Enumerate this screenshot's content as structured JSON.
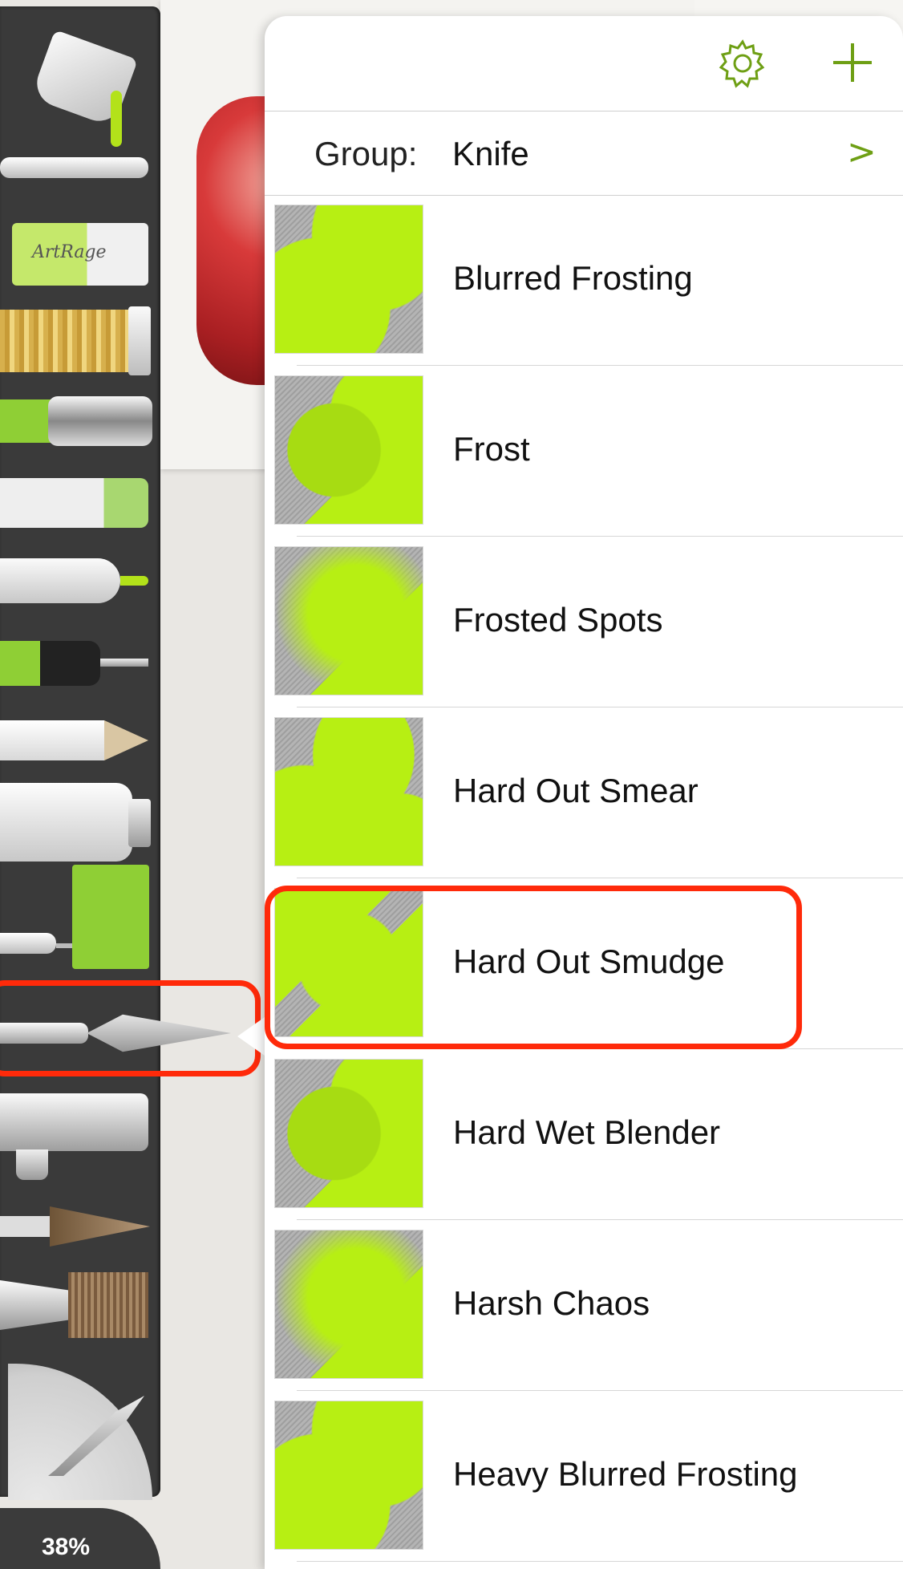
{
  "zoom": {
    "value": "38%"
  },
  "tools": [
    {
      "name": "paint-bucket"
    },
    {
      "name": "ink-pen"
    },
    {
      "name": "eraser",
      "label": "ArtRage"
    },
    {
      "name": "glitter-tube"
    },
    {
      "name": "marker"
    },
    {
      "name": "paint-tube-sticker"
    },
    {
      "name": "felt-pen"
    },
    {
      "name": "technical-pen"
    },
    {
      "name": "pencil"
    },
    {
      "name": "oil-paint-tube"
    },
    {
      "name": "paint-roller"
    },
    {
      "name": "palette-knife"
    },
    {
      "name": "airbrush"
    },
    {
      "name": "round-brush"
    },
    {
      "name": "flat-brush"
    }
  ],
  "panel": {
    "group_label": "Group:",
    "group_value": "Knife",
    "chevron": ">",
    "accent_color": "#6e9f14",
    "presets": [
      {
        "label": "Blurred Frosting",
        "style": "a"
      },
      {
        "label": "Frost",
        "style": "b"
      },
      {
        "label": "Frosted Spots",
        "style": "c"
      },
      {
        "label": "Hard Out Smear",
        "style": "d"
      },
      {
        "label": "Hard Out Smudge",
        "style": "e"
      },
      {
        "label": "Hard Wet Blender",
        "style": "b"
      },
      {
        "label": "Harsh Chaos",
        "style": "c"
      },
      {
        "label": "Heavy Blurred Frosting",
        "style": "a"
      }
    ],
    "selected_preset": "Hard Out Smudge"
  },
  "highlight_color": "#ff2a0a"
}
